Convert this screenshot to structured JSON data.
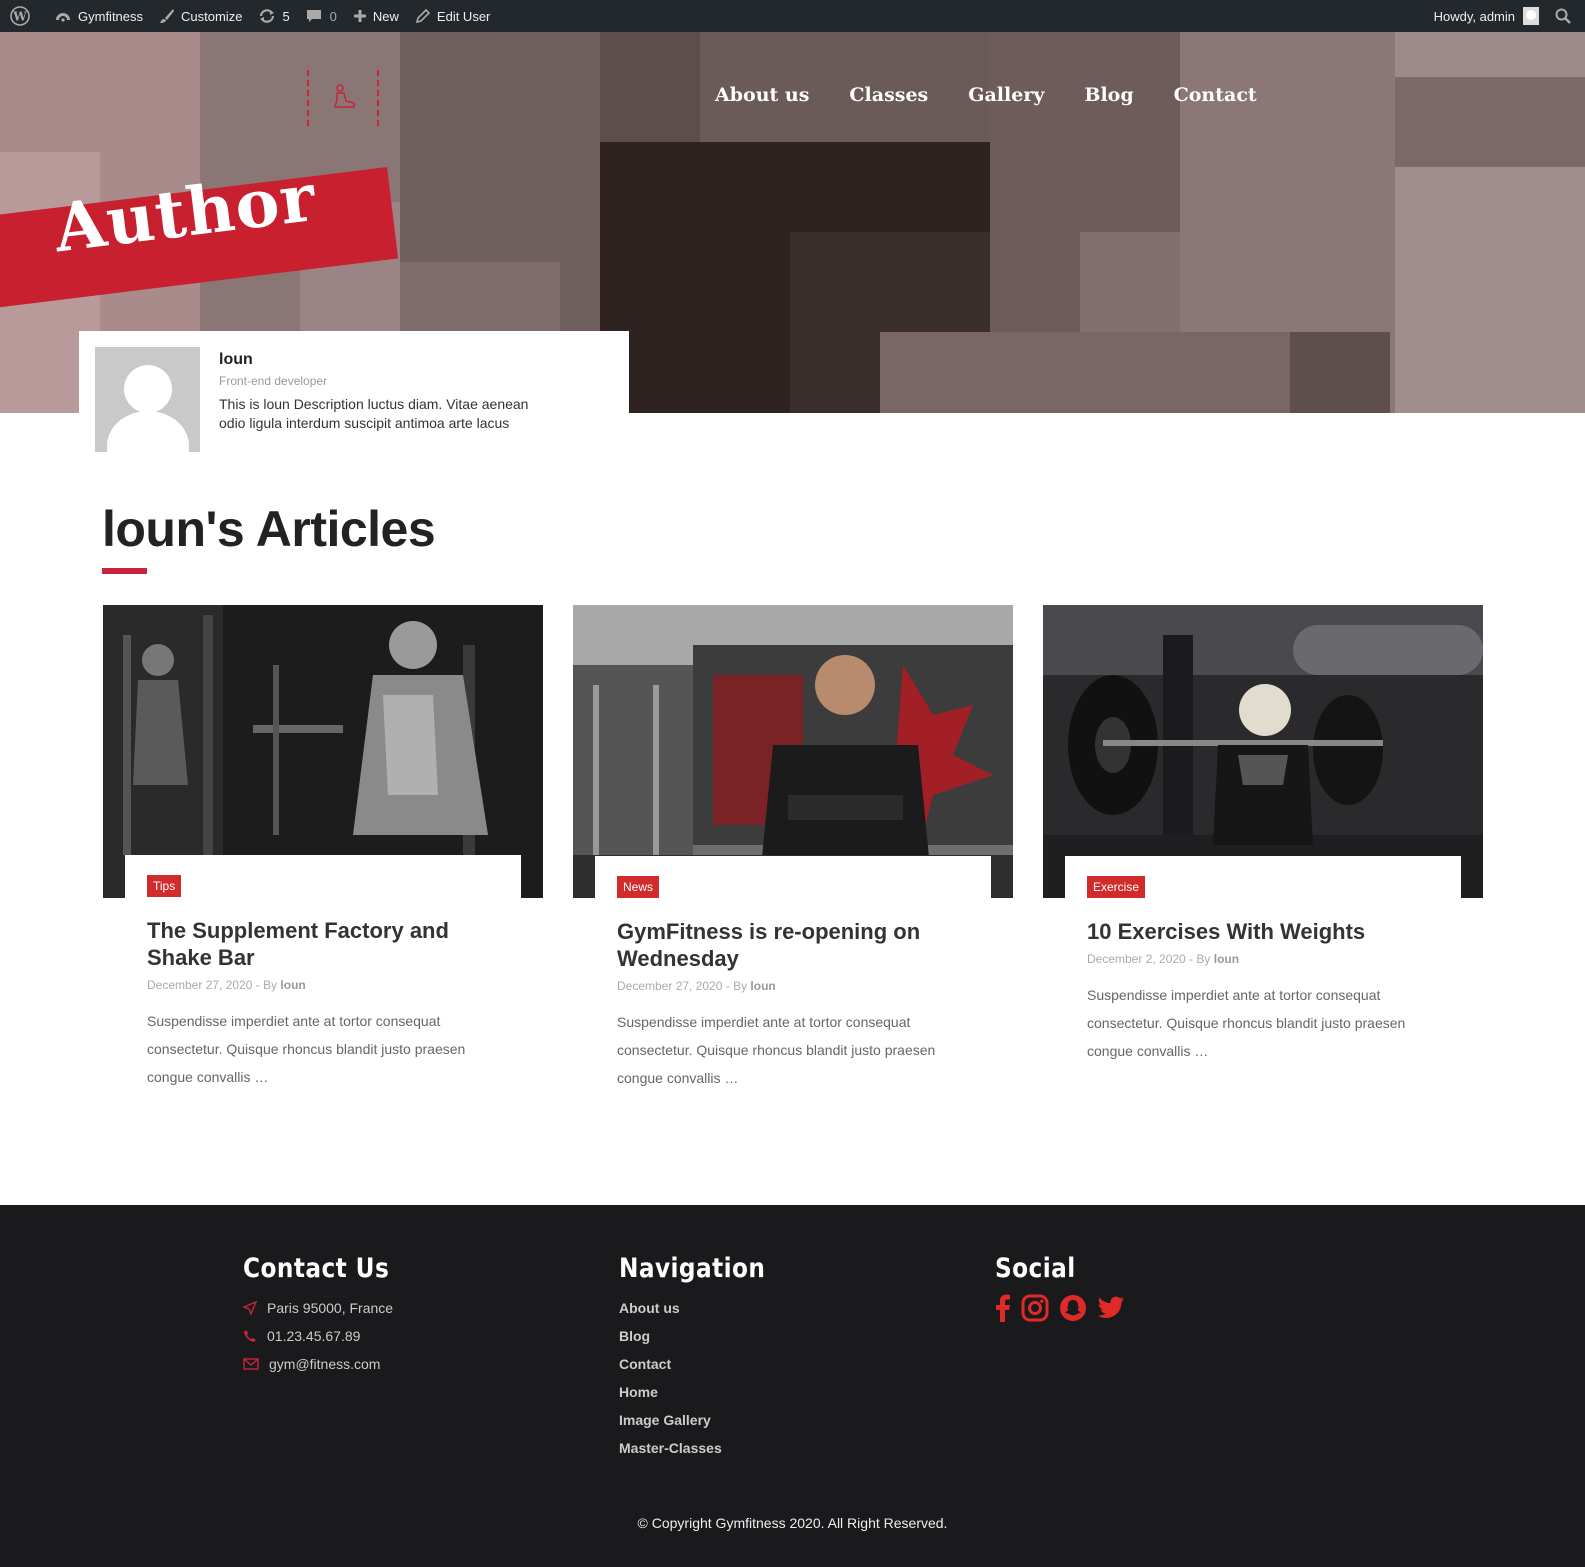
{
  "adminbar": {
    "site": "Gymfitness",
    "customize": "Customize",
    "updates": "5",
    "comments": "0",
    "new": "New",
    "edit_user": "Edit User",
    "howdy": "Howdy, admin"
  },
  "nav": {
    "items": [
      "About us",
      "Classes",
      "Gallery",
      "Blog",
      "Contact"
    ]
  },
  "hero": {
    "banner": "Author"
  },
  "author": {
    "name": "loun",
    "role": "Front-end developer",
    "description": "This is loun Description luctus diam. Vitae aenean odio ligula interdum suscipit antimoa arte lacus"
  },
  "articles": {
    "title": "loun's Articles",
    "items": [
      {
        "tag": "Tips",
        "title": "The Supplement Factory and Shake Bar",
        "date": "December 27, 2020 - By",
        "author": "loun",
        "excerpt": "Suspendisse imperdiet ante at tortor consequat consectetur. Quisque rhoncus blandit justo praesen congue convallis …"
      },
      {
        "tag": "News",
        "title": "GymFitness is re-opening on Wednesday",
        "date": "December 27, 2020 - By",
        "author": "loun",
        "excerpt": "Suspendisse imperdiet ante at tortor consequat consectetur. Quisque rhoncus blandit justo praesen congue convallis …"
      },
      {
        "tag": "Exercise",
        "title": "10 Exercises With Weights",
        "date": "December 2, 2020 - By",
        "author": "loun",
        "excerpt": "Suspendisse imperdiet ante at tortor consequat consectetur. Quisque rhoncus blandit justo praesen congue convallis …"
      }
    ]
  },
  "footer": {
    "contact": {
      "title": "Contact Us",
      "address": "Paris 95000, France",
      "phone": "01.23.45.67.89",
      "email": "gym@fitness.com"
    },
    "navigation": {
      "title": "Navigation",
      "links": [
        "About us",
        "Blog",
        "Contact",
        "Home",
        "Image Gallery",
        "Master-Classes"
      ]
    },
    "social": {
      "title": "Social",
      "icons": [
        "facebook-icon",
        "instagram-icon",
        "snapchat-icon",
        "twitter-icon"
      ]
    },
    "copyright": "© Copyright Gymfitness 2020. All Right Reserved."
  },
  "colors": {
    "accent": "#c9243a",
    "adminbar": "#23282d",
    "footer": "#1a1a1d"
  }
}
